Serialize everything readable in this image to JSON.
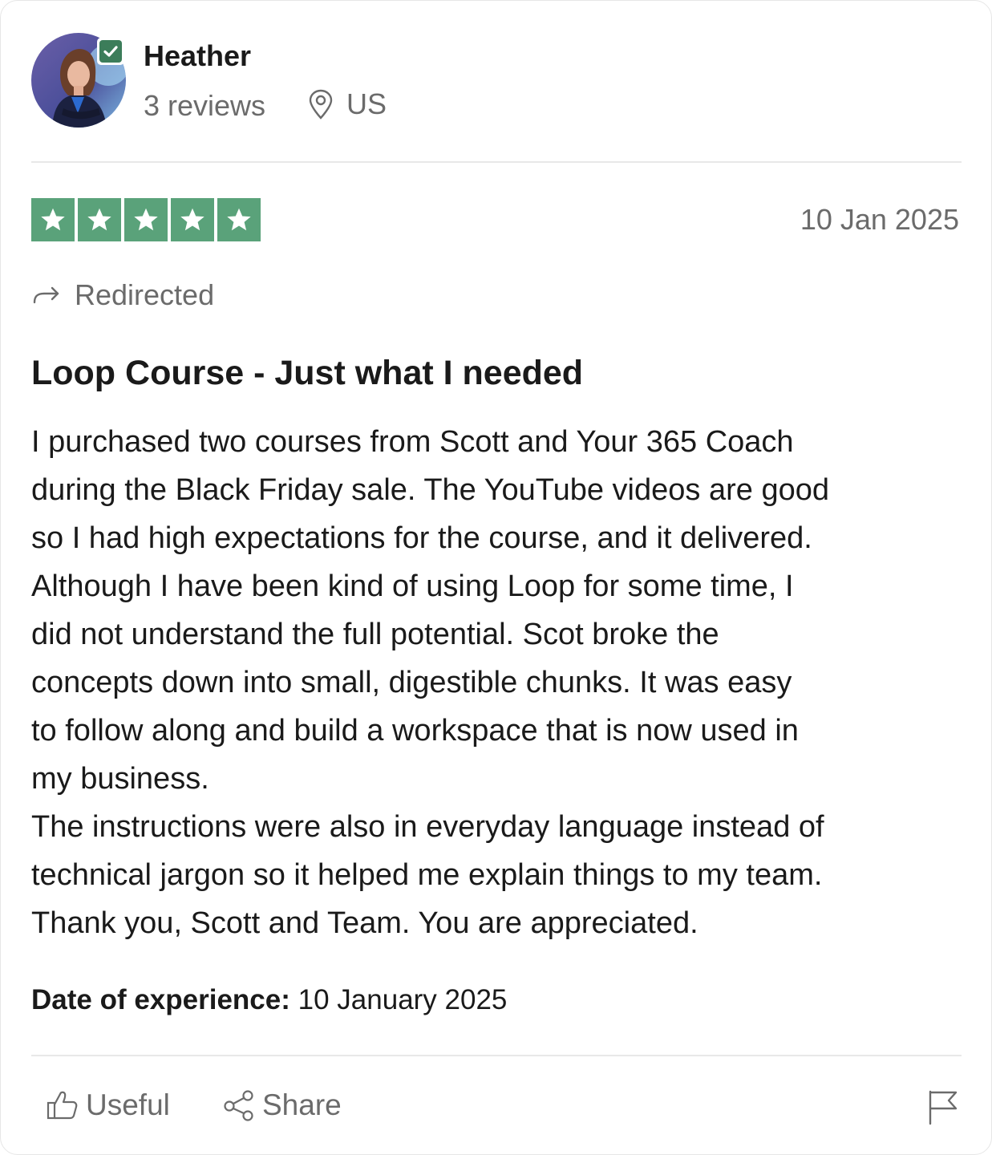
{
  "reviewer": {
    "name": "Heather",
    "review_count": "3 reviews",
    "location": "US"
  },
  "rating": {
    "stars": 5,
    "out_of": 5,
    "color": "#5aa27a"
  },
  "review": {
    "date": "10 Jan 2025",
    "redirected_label": "Redirected",
    "title": "Loop Course - Just what I needed",
    "body_lines": [
      "I purchased two courses from Scott and Your 365 Coach",
      "during the Black Friday sale. The YouTube videos are good",
      "so I had high expectations for the course, and it delivered.",
      "Although I have been kind of using Loop for some time, I",
      "did not understand the full potential. Scot broke the",
      "concepts down into small, digestible chunks. It was easy",
      "to follow along and build a workspace that is now used in",
      "my business.",
      "The instructions were also in everyday language instead of",
      "technical jargon so it helped me explain things to my team.",
      "Thank you, Scott and Team. You are appreciated."
    ],
    "experience_label": "Date of experience:",
    "experience_date": "10 January 2025"
  },
  "actions": {
    "useful_label": "Useful",
    "share_label": "Share"
  },
  "icons": {
    "verified": "verified-check-icon",
    "location": "location-pin-icon",
    "redirect": "redirect-arrow-icon",
    "useful": "thumbs-up-icon",
    "share": "share-icon",
    "flag": "flag-icon"
  },
  "colors": {
    "star_green": "#5aa27a",
    "verified_green": "#3c7d5a",
    "muted_text": "#6b6b6b",
    "primary_text": "#1a1a1a"
  }
}
